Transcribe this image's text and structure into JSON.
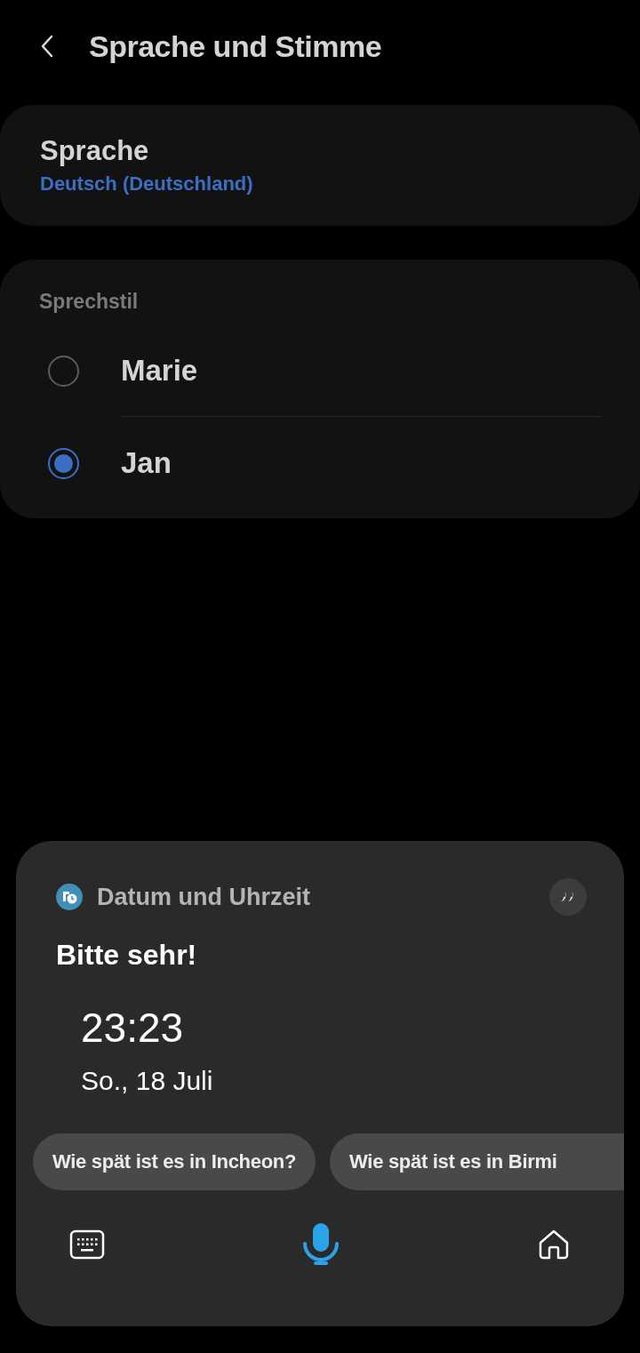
{
  "header": {
    "title": "Sprache und Stimme"
  },
  "language": {
    "label": "Sprache",
    "value": "Deutsch (Deutschland)"
  },
  "voice_style": {
    "heading": "Sprechstil",
    "options": [
      {
        "label": "Marie",
        "selected": false
      },
      {
        "label": "Jan",
        "selected": true
      }
    ]
  },
  "assistant": {
    "source": "Datum und Uhrzeit",
    "reply": "Bitte sehr!",
    "time": "23:23",
    "date": "So., 18 Juli",
    "suggestions": [
      {
        "label": "Wie spät ist es in Incheon?",
        "cut": false
      },
      {
        "label": "Wie spät ist es in Birmi",
        "cut": true
      }
    ]
  }
}
